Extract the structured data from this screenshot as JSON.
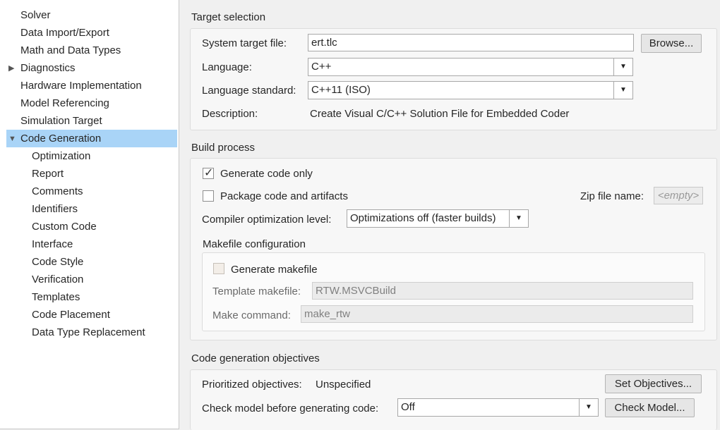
{
  "sidebar": {
    "items": [
      {
        "label": "Solver"
      },
      {
        "label": "Data Import/Export"
      },
      {
        "label": "Math and Data Types"
      },
      {
        "label": "Diagnostics",
        "expander": "▶"
      },
      {
        "label": "Hardware Implementation"
      },
      {
        "label": "Model Referencing"
      },
      {
        "label": "Simulation Target"
      },
      {
        "label": "Code Generation",
        "expander": "▼",
        "selected": true
      },
      {
        "label": "Optimization"
      },
      {
        "label": "Report"
      },
      {
        "label": "Comments"
      },
      {
        "label": "Identifiers"
      },
      {
        "label": "Custom Code"
      },
      {
        "label": "Interface"
      },
      {
        "label": "Code Style"
      },
      {
        "label": "Verification"
      },
      {
        "label": "Templates"
      },
      {
        "label": "Code Placement"
      },
      {
        "label": "Data Type Replacement"
      }
    ]
  },
  "target_selection": {
    "title": "Target selection",
    "system_target_label": "System target file:",
    "system_target_value": "ert.tlc",
    "browse_label": "Browse...",
    "language_label": "Language:",
    "language_value": "C++",
    "standard_label": "Language standard:",
    "standard_value": "C++11 (ISO)",
    "description_label": "Description:",
    "description_value": "Create Visual C/C++ Solution File for Embedded Coder"
  },
  "build_process": {
    "title": "Build process",
    "generate_code_only_label": "Generate code only",
    "generate_code_only_checked": true,
    "package_label": "Package code and artifacts",
    "package_checked": false,
    "zip_label": "Zip file name:",
    "zip_placeholder": "<empty>",
    "compiler_label": "Compiler optimization level:",
    "compiler_value": "Optimizations off (faster builds)",
    "makefile": {
      "title": "Makefile configuration",
      "generate_makefile_label": "Generate makefile",
      "generate_makefile_checked": false,
      "template_label": "Template makefile:",
      "template_value": "RTW.MSVCBuild",
      "make_command_label": "Make command:",
      "make_command_value": "make_rtw"
    }
  },
  "objectives": {
    "title": "Code generation objectives",
    "prioritized_label": "Prioritized objectives:",
    "prioritized_value": "Unspecified",
    "set_objectives_label": "Set Objectives...",
    "check_model_label": "Check model before generating code:",
    "check_model_value": "Off",
    "check_model_button": "Check Model..."
  },
  "colors": {
    "selection": "#a9d4f7",
    "panel": "#f7f7f7",
    "background": "#f0f0f0"
  }
}
